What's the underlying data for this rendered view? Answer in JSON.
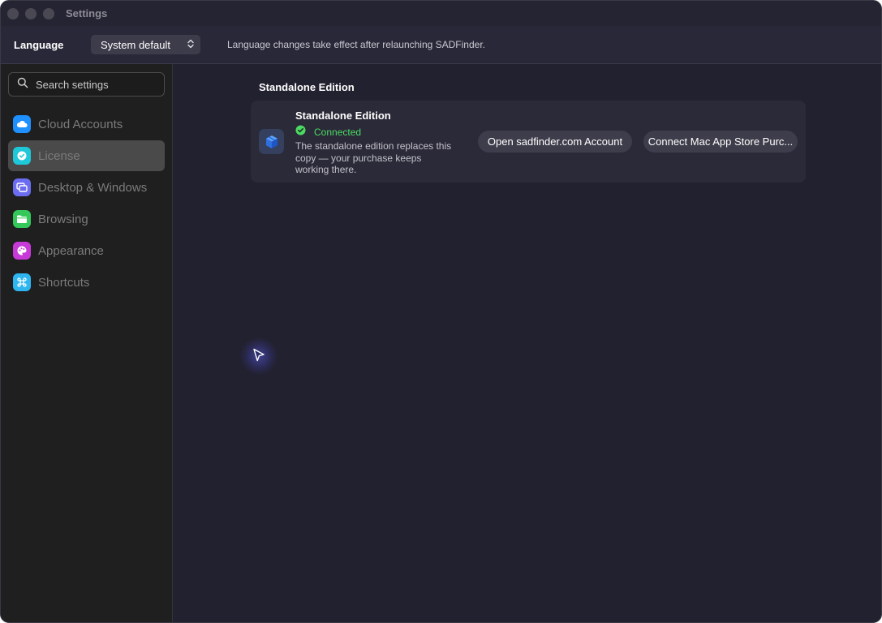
{
  "window": {
    "title": "Settings"
  },
  "language_bar": {
    "label": "Language",
    "selected": "System default",
    "note": "Language changes take effect after relaunching SADFinder."
  },
  "search": {
    "placeholder": "Search settings"
  },
  "sidebar": {
    "items": [
      {
        "label": "Cloud Accounts",
        "icon": "cloud-icon",
        "color": "#1e90ff",
        "active": false
      },
      {
        "label": "License",
        "icon": "checkmark-seal-icon",
        "color": "#1ec8d8",
        "active": true
      },
      {
        "label": "Desktop & Windows",
        "icon": "windows-icon",
        "color": "#6b6cf0",
        "active": false
      },
      {
        "label": "Browsing",
        "icon": "folder-icon",
        "color": "#34c759",
        "active": false
      },
      {
        "label": "Appearance",
        "icon": "palette-icon",
        "color": "#c83ad8",
        "active": false
      },
      {
        "label": "Shortcuts",
        "icon": "command-icon",
        "color": "#2fb6f0",
        "active": false
      }
    ]
  },
  "license": {
    "section_title": "Standalone Edition",
    "card_title": "Standalone Edition",
    "status": "Connected",
    "status_color": "#4cd964",
    "description": "The standalone edition replaces this copy — your purchase keeps working there.",
    "product_icon": "cube-icon",
    "open_account_label": "Open sadfinder.com Account",
    "connect_store_label": "Connect Mac App Store Purc..."
  }
}
